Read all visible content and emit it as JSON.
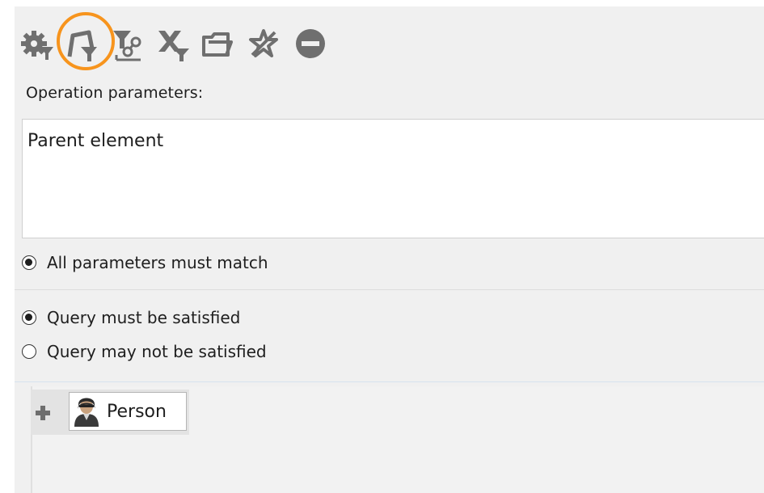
{
  "toolbar": {
    "icons": [
      {
        "name": "gear-filter-icon",
        "label": ""
      },
      {
        "name": "filter-path-icon",
        "label": "",
        "highlighted": true
      },
      {
        "name": "filter-relation-icon",
        "label": ""
      },
      {
        "name": "cross-filter-icon",
        "label": ""
      },
      {
        "name": "open-folder-icon",
        "label": ""
      },
      {
        "name": "star-remove-icon",
        "label": ""
      },
      {
        "name": "minus-circle-icon",
        "label": ""
      }
    ],
    "icon_color": "#6f6f6f",
    "highlight_color": "#f7941d"
  },
  "operation_parameters": {
    "label": "Operation parameters:",
    "items": [
      "Parent element"
    ]
  },
  "match_option": {
    "label": "All parameters must match",
    "checked": true
  },
  "query_options": [
    {
      "label": "Query must be satisfied",
      "checked": true
    },
    {
      "label": "Query may not be satisfied",
      "checked": false
    }
  ],
  "query_tree": {
    "add_icon": "plus-icon",
    "node_icon": "person-icon",
    "node_label": "Person"
  }
}
